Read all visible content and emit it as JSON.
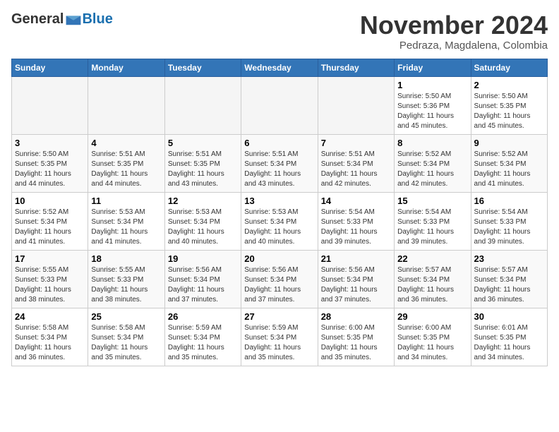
{
  "header": {
    "logo_general": "General",
    "logo_blue": "Blue",
    "month": "November 2024",
    "location": "Pedraza, Magdalena, Colombia"
  },
  "weekdays": [
    "Sunday",
    "Monday",
    "Tuesday",
    "Wednesday",
    "Thursday",
    "Friday",
    "Saturday"
  ],
  "weeks": [
    [
      {
        "day": "",
        "info": ""
      },
      {
        "day": "",
        "info": ""
      },
      {
        "day": "",
        "info": ""
      },
      {
        "day": "",
        "info": ""
      },
      {
        "day": "",
        "info": ""
      },
      {
        "day": "1",
        "info": "Sunrise: 5:50 AM\nSunset: 5:36 PM\nDaylight: 11 hours\nand 45 minutes."
      },
      {
        "day": "2",
        "info": "Sunrise: 5:50 AM\nSunset: 5:35 PM\nDaylight: 11 hours\nand 45 minutes."
      }
    ],
    [
      {
        "day": "3",
        "info": "Sunrise: 5:50 AM\nSunset: 5:35 PM\nDaylight: 11 hours\nand 44 minutes."
      },
      {
        "day": "4",
        "info": "Sunrise: 5:51 AM\nSunset: 5:35 PM\nDaylight: 11 hours\nand 44 minutes."
      },
      {
        "day": "5",
        "info": "Sunrise: 5:51 AM\nSunset: 5:35 PM\nDaylight: 11 hours\nand 43 minutes."
      },
      {
        "day": "6",
        "info": "Sunrise: 5:51 AM\nSunset: 5:34 PM\nDaylight: 11 hours\nand 43 minutes."
      },
      {
        "day": "7",
        "info": "Sunrise: 5:51 AM\nSunset: 5:34 PM\nDaylight: 11 hours\nand 42 minutes."
      },
      {
        "day": "8",
        "info": "Sunrise: 5:52 AM\nSunset: 5:34 PM\nDaylight: 11 hours\nand 42 minutes."
      },
      {
        "day": "9",
        "info": "Sunrise: 5:52 AM\nSunset: 5:34 PM\nDaylight: 11 hours\nand 41 minutes."
      }
    ],
    [
      {
        "day": "10",
        "info": "Sunrise: 5:52 AM\nSunset: 5:34 PM\nDaylight: 11 hours\nand 41 minutes."
      },
      {
        "day": "11",
        "info": "Sunrise: 5:53 AM\nSunset: 5:34 PM\nDaylight: 11 hours\nand 41 minutes."
      },
      {
        "day": "12",
        "info": "Sunrise: 5:53 AM\nSunset: 5:34 PM\nDaylight: 11 hours\nand 40 minutes."
      },
      {
        "day": "13",
        "info": "Sunrise: 5:53 AM\nSunset: 5:34 PM\nDaylight: 11 hours\nand 40 minutes."
      },
      {
        "day": "14",
        "info": "Sunrise: 5:54 AM\nSunset: 5:33 PM\nDaylight: 11 hours\nand 39 minutes."
      },
      {
        "day": "15",
        "info": "Sunrise: 5:54 AM\nSunset: 5:33 PM\nDaylight: 11 hours\nand 39 minutes."
      },
      {
        "day": "16",
        "info": "Sunrise: 5:54 AM\nSunset: 5:33 PM\nDaylight: 11 hours\nand 39 minutes."
      }
    ],
    [
      {
        "day": "17",
        "info": "Sunrise: 5:55 AM\nSunset: 5:33 PM\nDaylight: 11 hours\nand 38 minutes."
      },
      {
        "day": "18",
        "info": "Sunrise: 5:55 AM\nSunset: 5:33 PM\nDaylight: 11 hours\nand 38 minutes."
      },
      {
        "day": "19",
        "info": "Sunrise: 5:56 AM\nSunset: 5:34 PM\nDaylight: 11 hours\nand 37 minutes."
      },
      {
        "day": "20",
        "info": "Sunrise: 5:56 AM\nSunset: 5:34 PM\nDaylight: 11 hours\nand 37 minutes."
      },
      {
        "day": "21",
        "info": "Sunrise: 5:56 AM\nSunset: 5:34 PM\nDaylight: 11 hours\nand 37 minutes."
      },
      {
        "day": "22",
        "info": "Sunrise: 5:57 AM\nSunset: 5:34 PM\nDaylight: 11 hours\nand 36 minutes."
      },
      {
        "day": "23",
        "info": "Sunrise: 5:57 AM\nSunset: 5:34 PM\nDaylight: 11 hours\nand 36 minutes."
      }
    ],
    [
      {
        "day": "24",
        "info": "Sunrise: 5:58 AM\nSunset: 5:34 PM\nDaylight: 11 hours\nand 36 minutes."
      },
      {
        "day": "25",
        "info": "Sunrise: 5:58 AM\nSunset: 5:34 PM\nDaylight: 11 hours\nand 35 minutes."
      },
      {
        "day": "26",
        "info": "Sunrise: 5:59 AM\nSunset: 5:34 PM\nDaylight: 11 hours\nand 35 minutes."
      },
      {
        "day": "27",
        "info": "Sunrise: 5:59 AM\nSunset: 5:34 PM\nDaylight: 11 hours\nand 35 minutes."
      },
      {
        "day": "28",
        "info": "Sunrise: 6:00 AM\nSunset: 5:35 PM\nDaylight: 11 hours\nand 35 minutes."
      },
      {
        "day": "29",
        "info": "Sunrise: 6:00 AM\nSunset: 5:35 PM\nDaylight: 11 hours\nand 34 minutes."
      },
      {
        "day": "30",
        "info": "Sunrise: 6:01 AM\nSunset: 5:35 PM\nDaylight: 11 hours\nand 34 minutes."
      }
    ]
  ]
}
